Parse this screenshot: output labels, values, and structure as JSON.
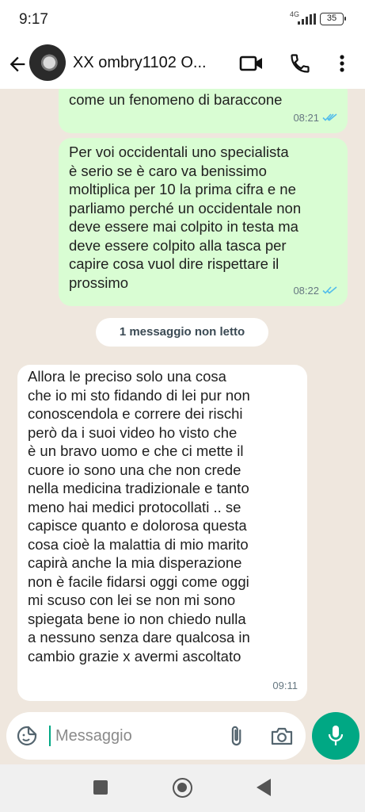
{
  "status_bar": {
    "time": "9:17",
    "network": "4G",
    "battery": "35"
  },
  "header": {
    "contact_name": "XX ombry1102 O...",
    "icons": [
      "back-arrow-icon",
      "video-call-icon",
      "phone-icon",
      "more-vertical-icon"
    ]
  },
  "messages": [
    {
      "direction": "outgoing",
      "text": "come un fenomeno di baraccone",
      "time": "08:21",
      "status": "read"
    },
    {
      "direction": "outgoing",
      "text": "Per voi occidentali uno specialista\nè serio se è caro va benissimo\nmoltiplica per 10 la prima cifra e ne\nparliamo perché un occidentale non\ndeve essere mai colpito in testa ma\ndeve essere colpito alla tasca per\ncapire cosa vuol dire rispettare il\nprossimo",
      "time": "08:22",
      "status": "read"
    },
    {
      "direction": "incoming",
      "text": "Allora le preciso solo una cosa\nche io mi sto fidando di lei pur non\nconoscendola  e correre dei rischi\nperò da i suoi  video ho visto che\nè un bravo uomo e che ci mette il\ncuore  io sono una che non crede\nnella medicina tradizionale e tanto\nmeno hai medici protocollati ..  se\ncapisce quanto e dolorosa questa\ncosa  cioè la malattia di mio marito\ncapirà anche la mia disperazione\nnon è facile fidarsi oggi come oggi\nmi scuso con lei se non mi sono\nspiegata bene io non chiedo nulla\na nessuno senza dare qualcosa in\ncambio  grazie x avermi ascoltato",
      "time": "09:11"
    }
  ],
  "unread_divider": "1 messaggio non letto",
  "composer": {
    "placeholder": "Messaggio",
    "value": ""
  },
  "colors": {
    "accent": "#00a884",
    "outgoing_bubble": "#d9fdd3",
    "incoming_bubble": "#ffffff",
    "read_ticks": "#53bdeb",
    "chat_background": "#efe7de"
  }
}
